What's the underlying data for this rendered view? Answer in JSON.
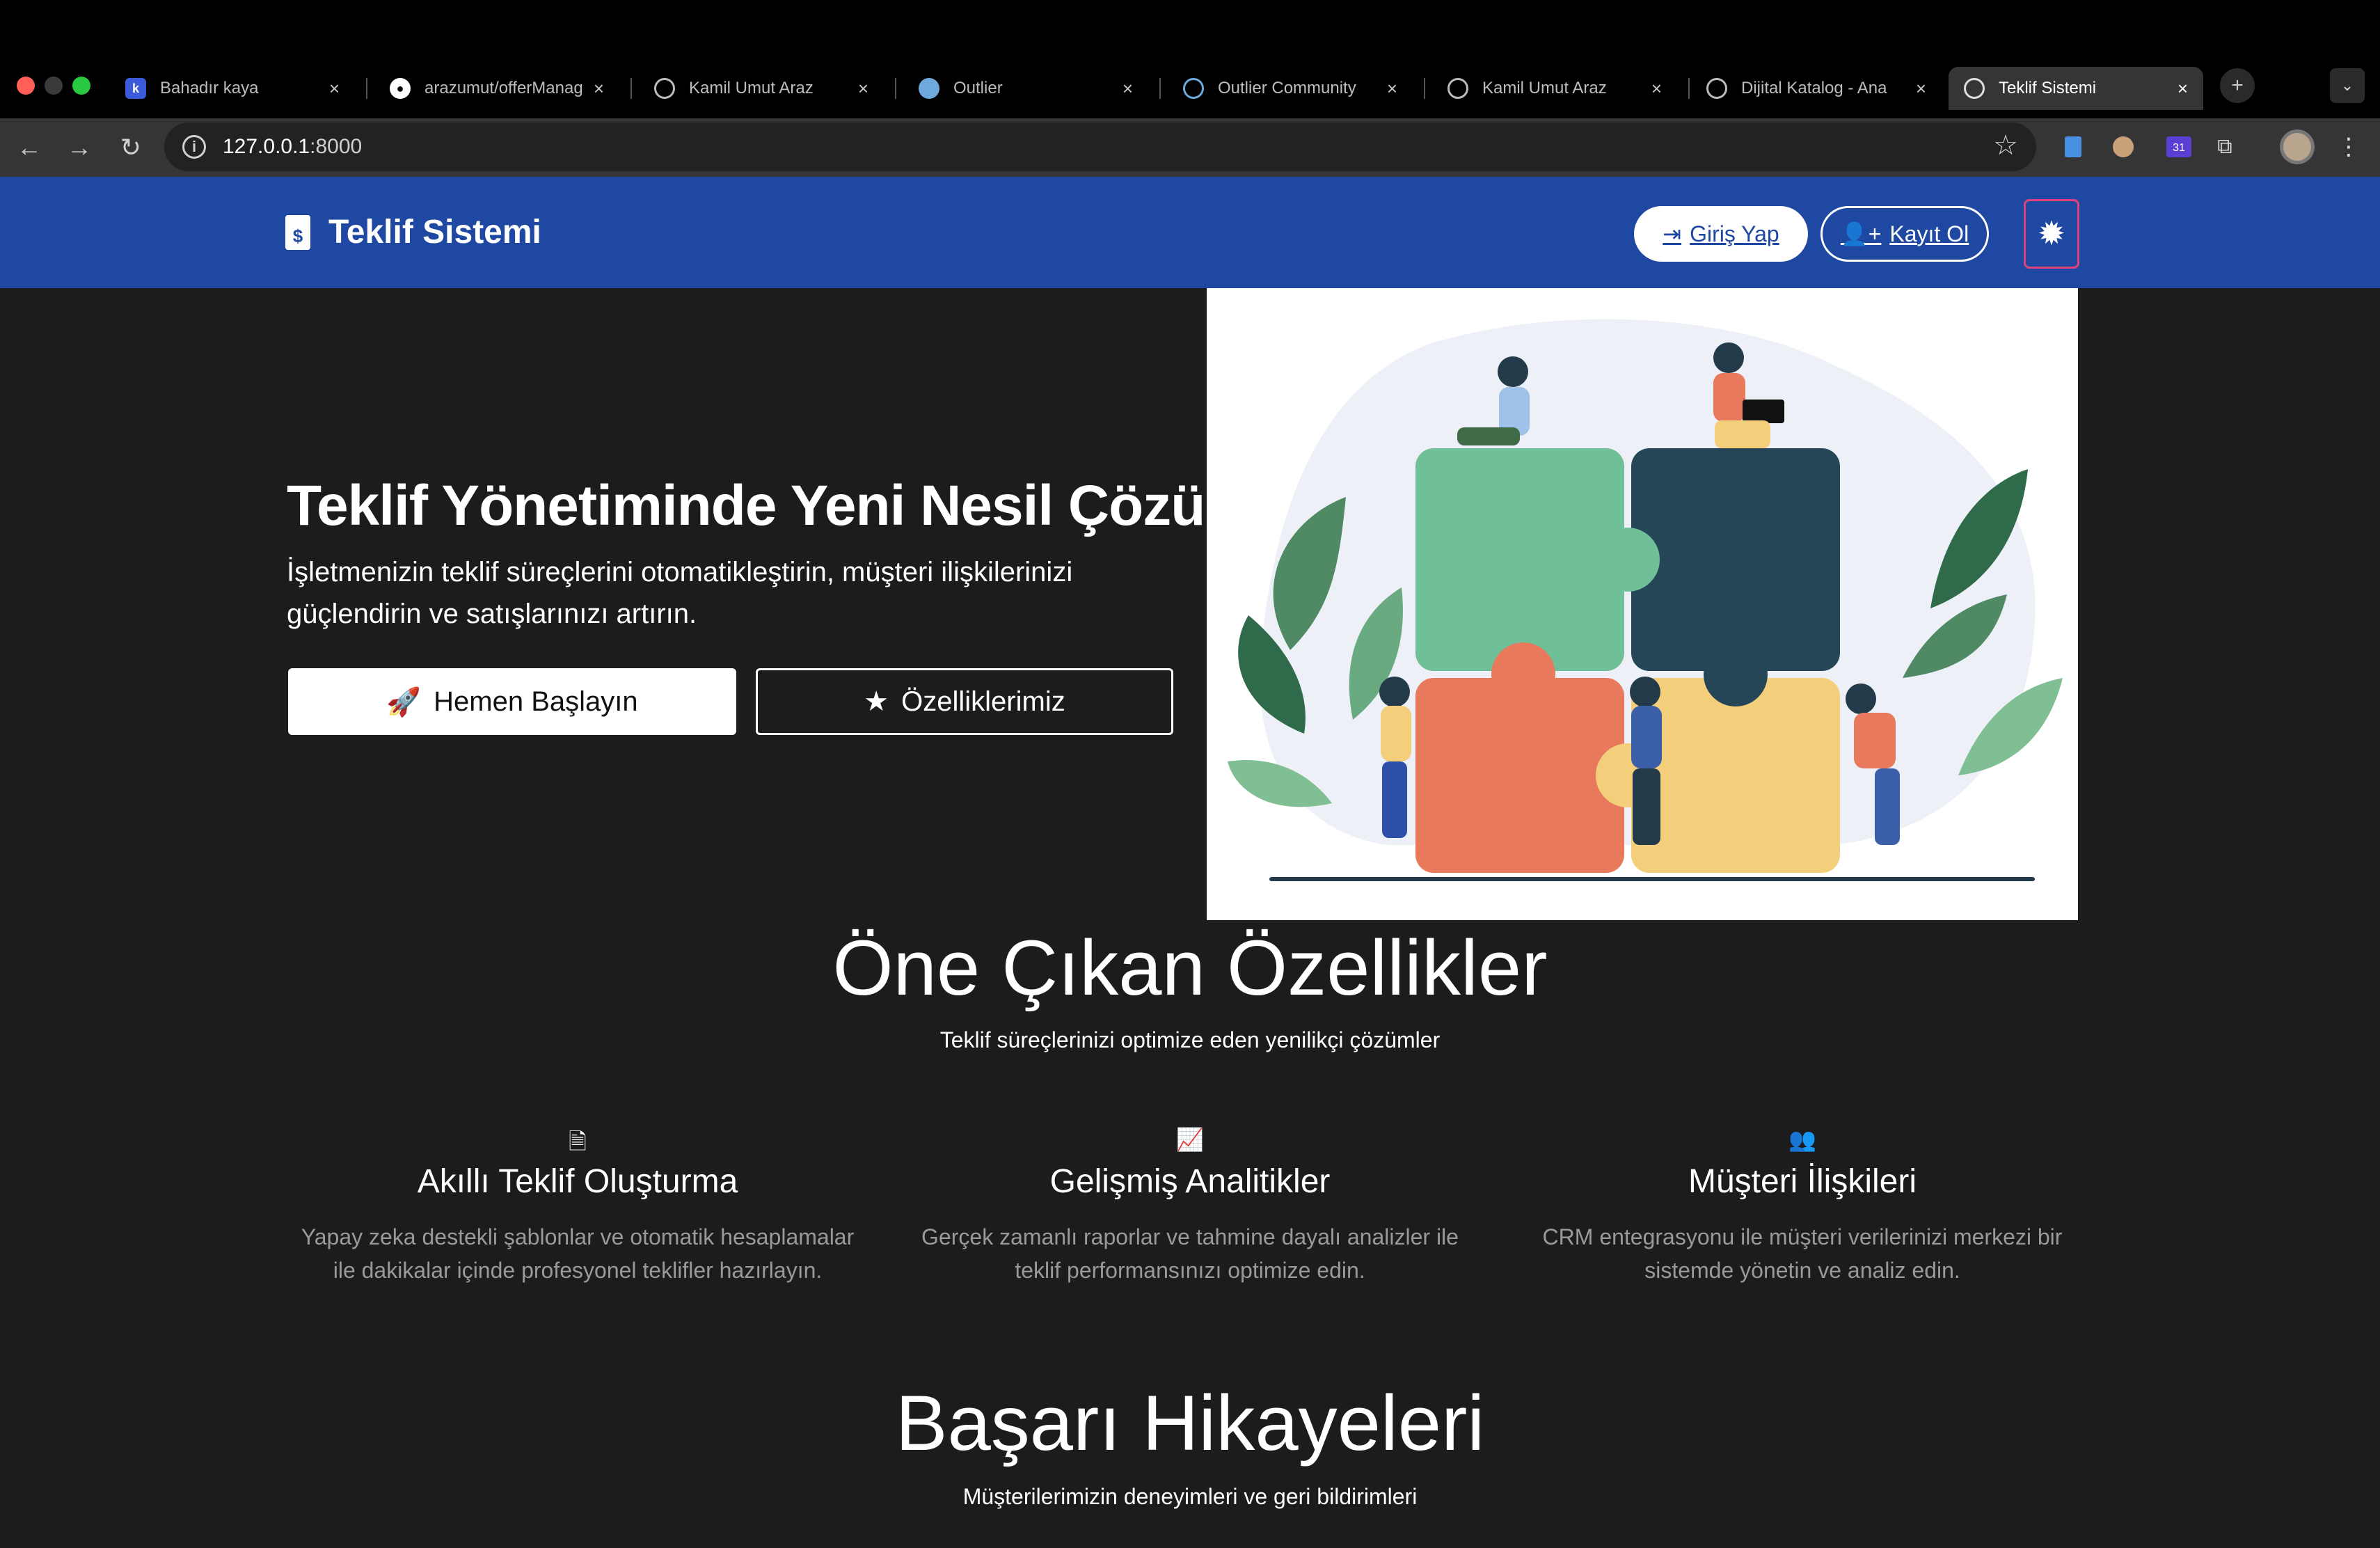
{
  "browser": {
    "tabs": [
      {
        "label": "Bahadır kaya",
        "favicon": "k-letter-icon",
        "active": false
      },
      {
        "label": "arazumut/offerManag",
        "favicon": "github-icon",
        "active": false
      },
      {
        "label": "Kamil Umut Araz",
        "favicon": "globe-icon",
        "active": false
      },
      {
        "label": "Outlier",
        "favicon": "outlier-icon",
        "active": false
      },
      {
        "label": "Outlier Community",
        "favicon": "outlier-community-icon",
        "active": false
      },
      {
        "label": "Kamil Umut Araz",
        "favicon": "globe-icon",
        "active": false
      },
      {
        "label": "Dijital Katalog - Ana",
        "favicon": "globe-icon",
        "active": false
      },
      {
        "label": "Teklif Sistemi",
        "favicon": "globe-icon",
        "active": true
      }
    ],
    "url_host": "127.0.0.1",
    "url_port": ":8000",
    "calendar_badge": "31"
  },
  "navbar": {
    "brand": "Teklif Sistemi",
    "login_label": "Giriş Yap",
    "register_label": "Kayıt Ol",
    "theme_icon": "sun-icon"
  },
  "hero": {
    "title": "Teklif Yönetiminde Yeni Nesil Çözüm",
    "subtitle": "İşletmenizin teklif süreçlerini otomatikleştirin, müşteri ilişkilerinizi güçlendirin ve satışlarınızı artırın.",
    "start_label": "Hemen Başlayın",
    "features_label": "Özelliklerimiz"
  },
  "features": {
    "title": "Öne Çıkan Özellikler",
    "subtitle": "Teklif süreçlerinizi optimize eden yenilikçi çözümler",
    "items": [
      {
        "icon": "invoice-icon",
        "title": "Akıllı Teklif Oluşturma",
        "desc": "Yapay zeka destekli şablonlar ve otomatik hesaplamalar ile dakikalar içinde profesyonel teklifler hazırlayın."
      },
      {
        "icon": "chart-line-icon",
        "title": "Gelişmiş Analitikler",
        "desc": "Gerçek zamanlı raporlar ve tahmine dayalı analizler ile teklif performansınızı optimize edin."
      },
      {
        "icon": "users-icon",
        "title": "Müşteri İlişkileri",
        "desc": "CRM entegrasyonu ile müşteri verilerinizi merkezi bir sistemde yönetin ve analiz edin."
      }
    ]
  },
  "stories": {
    "title": "Başarı Hikayeleri",
    "subtitle": "Müşterilerimizin deneyimleri ve geri bildirimleri"
  }
}
